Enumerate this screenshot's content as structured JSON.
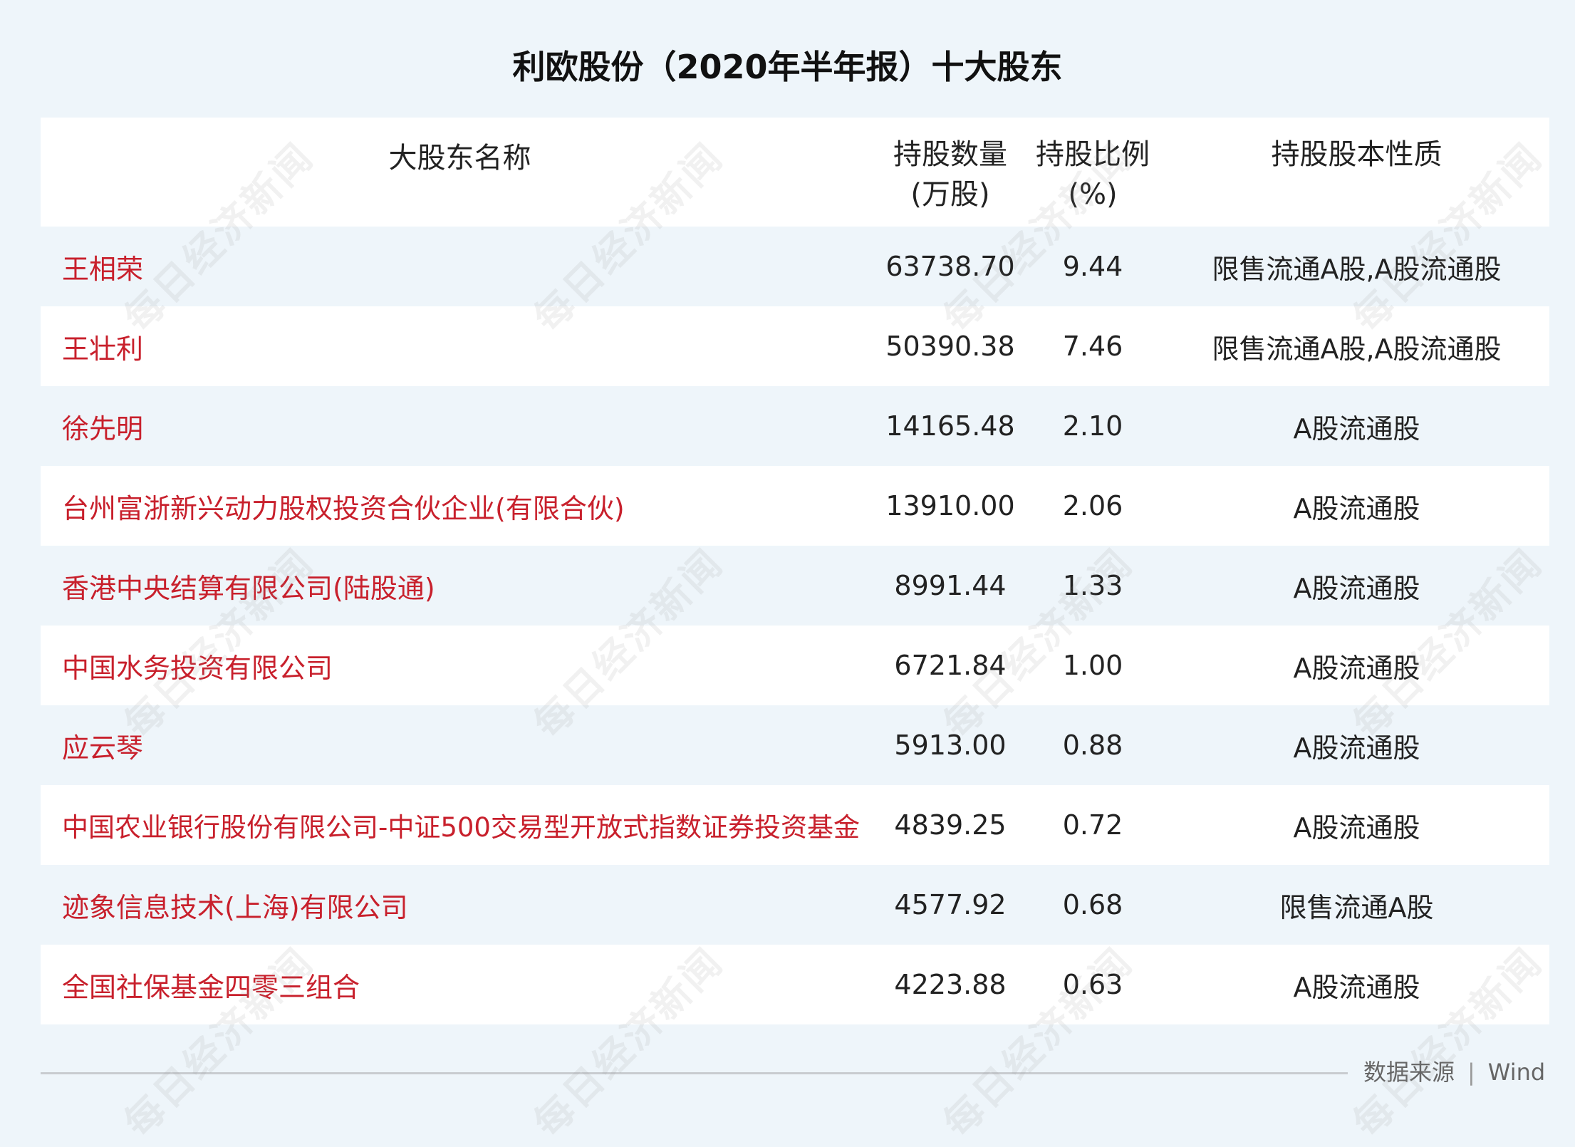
{
  "title": "利欧股份（2020年半年报）十大股东",
  "headers": {
    "name": "大股东名称",
    "shares_line1": "持股数量",
    "shares_line2": "(万股)",
    "ratio_line1": "持股比例",
    "ratio_line2": "(%)",
    "nature": "持股股本性质"
  },
  "rows": [
    {
      "name": "王相荣",
      "shares": "63738.70",
      "ratio": "9.44",
      "nature": "限售流通A股,A股流通股"
    },
    {
      "name": "王壮利",
      "shares": "50390.38",
      "ratio": "7.46",
      "nature": "限售流通A股,A股流通股"
    },
    {
      "name": "徐先明",
      "shares": "14165.48",
      "ratio": "2.10",
      "nature": "A股流通股"
    },
    {
      "name": "台州富浙新兴动力股权投资合伙企业(有限合伙)",
      "shares": "13910.00",
      "ratio": "2.06",
      "nature": "A股流通股"
    },
    {
      "name": "香港中央结算有限公司(陆股通)",
      "shares": "8991.44",
      "ratio": "1.33",
      "nature": "A股流通股"
    },
    {
      "name": "中国水务投资有限公司",
      "shares": "6721.84",
      "ratio": "1.00",
      "nature": "A股流通股"
    },
    {
      "name": "应云琴",
      "shares": "5913.00",
      "ratio": "0.88",
      "nature": "A股流通股"
    },
    {
      "name": "中国农业银行股份有限公司-中证500交易型开放式指数证券投资基金",
      "shares": "4839.25",
      "ratio": "0.72",
      "nature": "A股流通股"
    },
    {
      "name": "迹象信息技术(上海)有限公司",
      "shares": "4577.92",
      "ratio": "0.68",
      "nature": "限售流通A股"
    },
    {
      "name": "全国社保基金四零三组合",
      "shares": "4223.88",
      "ratio": "0.63",
      "nature": "A股流通股"
    }
  ],
  "source": {
    "label": "数据来源",
    "separator": "|",
    "value": "Wind"
  },
  "watermark": "每日经济新闻",
  "colors": {
    "background": "#eef5fa",
    "row_alt": "#ffffff",
    "name_text": "#c8202c",
    "body_text": "#222222"
  }
}
